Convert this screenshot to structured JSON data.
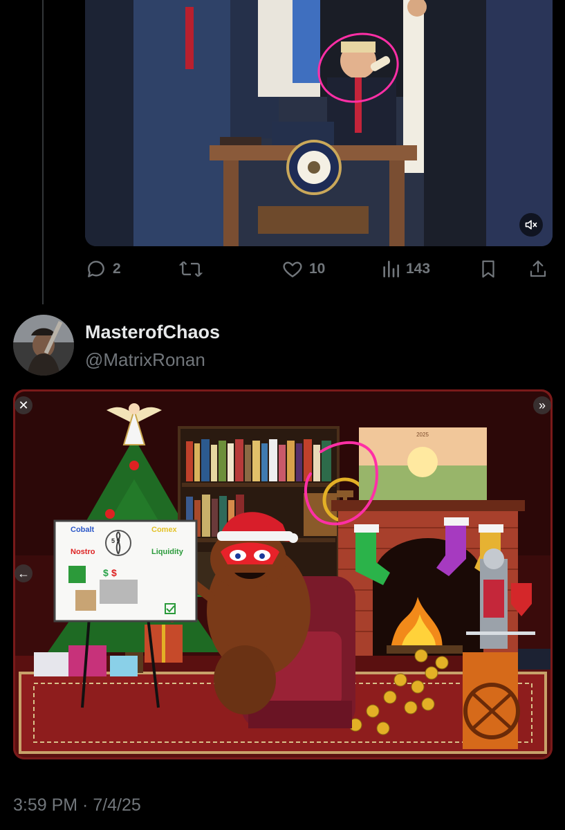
{
  "tweet_top": {
    "media_alt": "signing ceremony photo",
    "mute_icon": "speaker-muted-icon",
    "actions": {
      "replies": "2",
      "retweets": "",
      "likes": "10",
      "views": "143"
    }
  },
  "tweet_reply": {
    "display_name": "MasterofChaos",
    "handle": "@MatrixRonan",
    "board_labels": {
      "cobalt": "Cobalt",
      "comex": "Comex",
      "nostro": "Nostro",
      "liquidity": "Liquidity",
      "number": "5 9"
    },
    "timestamp": "3:59 PM · 7/4/25"
  },
  "colors": {
    "background": "#000000",
    "secondary_text": "#71767b",
    "primary_text": "#e7e9ea",
    "annotation_pink": "#ff2fa6"
  }
}
